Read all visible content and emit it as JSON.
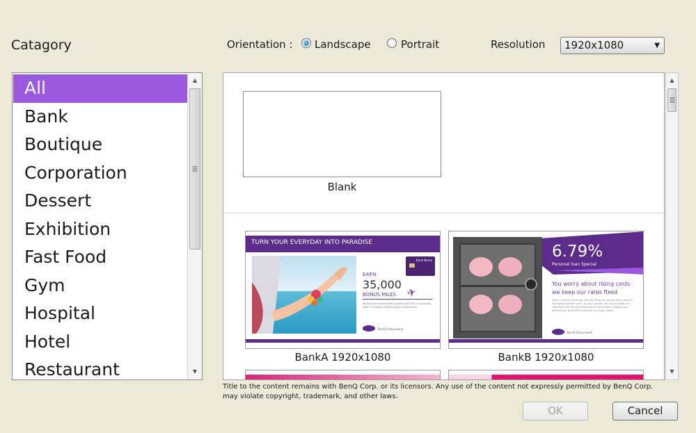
{
  "category": {
    "title": "Catagory",
    "items": [
      "All",
      "Bank",
      "Boutique",
      "Corporation",
      "Dessert",
      "Exhibition",
      "Fast Food",
      "Gym",
      "Hospital",
      "Hotel",
      "Restaurant"
    ],
    "selected": "All"
  },
  "orientation": {
    "label": "Orientation :",
    "options": [
      "Landscape",
      "Portrait"
    ],
    "selected": "Landscape"
  },
  "resolution": {
    "label": "Resolution",
    "value": "1920x1080"
  },
  "templates": {
    "blank_label": "Blank",
    "bank_a": {
      "caption": "BankA 1920x1080",
      "headline": "TURN YOUR EVERYDAY INTO PARADISE",
      "earn": "EARN",
      "miles": "35,000",
      "bonus": "BONUS MILES",
      "card_label": "Bank Name",
      "fine_print": "Airlines bonus miles after spending $2,500 in purchases within 3 months of becoming a cardmember.",
      "brand": "BenQ virtual bank"
    },
    "bank_b": {
      "caption": "BankB 1920x1080",
      "rate": "6.79%",
      "rate_sub": "Personal loan Special",
      "worry": "You worry about rising costs",
      "fixed": "we keep our rates fixed",
      "body": "When running a business, the last thing you should worry about is fluctuating interest rates. As your partner, we not only keep our rates fixed but also incredibly low and consistent. Helping you finance your business to achieve your goals faster.",
      "brand": "BenQ virtual bank"
    }
  },
  "copyright": "Title to the content remains with BenQ Corp. or its licensors. Any use of the content not expressly permitted by BenQ Corp. may violate copyright, trademark, and other laws.",
  "buttons": {
    "ok": "OK",
    "cancel": "Cancel"
  },
  "colors": {
    "accent": "#9b59e0",
    "bank_purple": "#5b2a8a",
    "radio_blue": "#1c6fb8"
  }
}
